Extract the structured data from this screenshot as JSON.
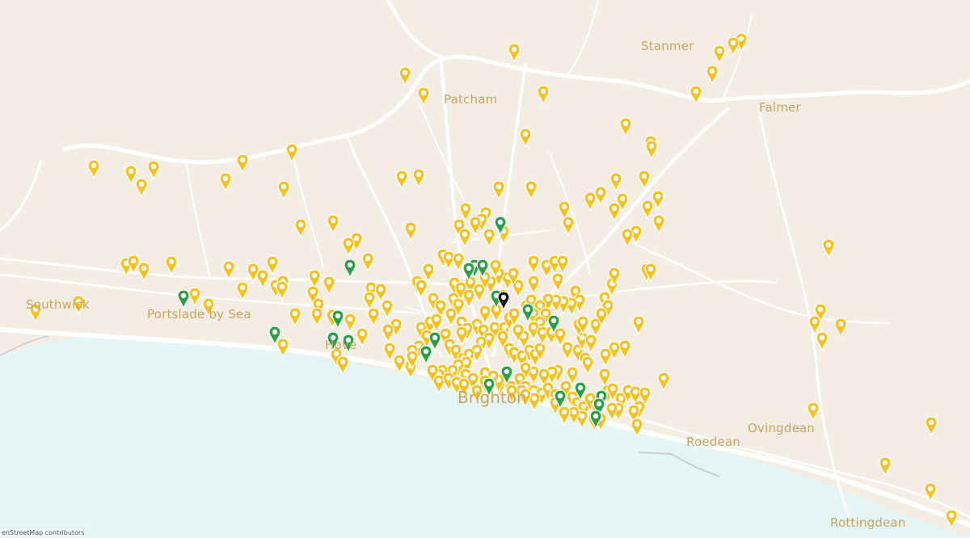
{
  "map": {
    "colors": {
      "land": "#f3ede3",
      "sea": "#e3f5f5",
      "road": "#ffffff",
      "label": "#c9a463",
      "marker_yellow": "#f7c21e",
      "marker_green": "#27a046",
      "marker_black": "#111111"
    },
    "labels": {
      "stanmer": "Stanmer",
      "patcham": "Patcham",
      "falmer": "Falmer",
      "southwick": "Southwick",
      "portslade": "Portslade by Sea",
      "hove": "Hove",
      "brighton": "Brighton",
      "ovingdean": "Ovingdean",
      "roedean": "Roedean",
      "rottingdean": "Rottingdean"
    },
    "attribution": "enStreetMap contributors"
  }
}
